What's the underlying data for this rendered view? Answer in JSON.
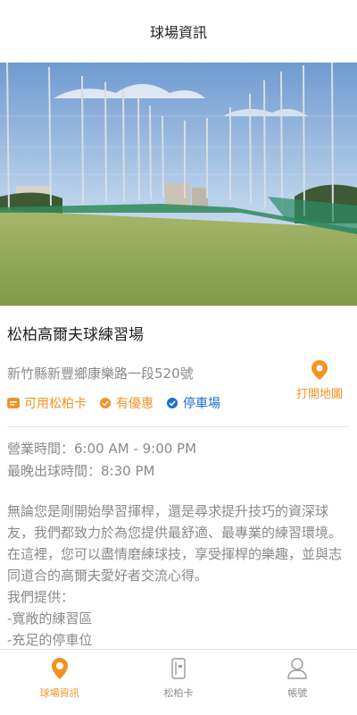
{
  "header": {
    "title": "球場資訊"
  },
  "hero": {
    "image_alt": "driving range photo"
  },
  "venue": {
    "name": "松柏高爾夫球練習場",
    "address": "新竹縣新豐鄉康樂路一段520號",
    "tags": [
      {
        "label": "可用松柏卡",
        "icon": "card-icon",
        "color": "#f39323"
      },
      {
        "label": "有優惠",
        "icon": "check-icon",
        "color": "#f39323"
      },
      {
        "label": "停車場",
        "icon": "check-icon",
        "color": "#1d6fd1"
      }
    ],
    "map_button": {
      "label": "打開地圖",
      "icon": "map-pin-icon"
    }
  },
  "hours": {
    "business": "營業時間：6:00 AM - 9:00 PM",
    "last_tee": "最晚出球時間：8:30 PM"
  },
  "description": {
    "paragraph": "無論您是剛開始學習揮桿，還是尋求提升技巧的資深球友，我們都致力於為您提供最舒適、最專業的練習環境。在這裡，您可以盡情磨練球技，享受揮桿的樂趣，並與志同道合的高爾夫愛好者交流心得。",
    "offer_title": "我們提供：",
    "offers": [
      "-寬敞的練習區",
      "-充足的停車位"
    ]
  },
  "tabbar": {
    "items": [
      {
        "label": "球場資訊",
        "icon": "map-pin-icon",
        "active": true
      },
      {
        "label": "松柏卡",
        "icon": "card-icon",
        "active": false
      },
      {
        "label": "帳號",
        "icon": "user-icon",
        "active": false
      }
    ]
  },
  "colors": {
    "accent": "#f39323",
    "blue": "#1d6fd1",
    "muted": "#8a8a8a"
  }
}
